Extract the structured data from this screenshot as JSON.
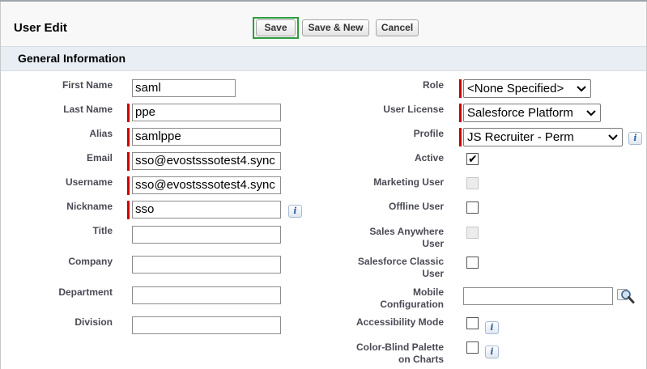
{
  "page": {
    "title": "User Edit"
  },
  "toolbar": {
    "save_label": "Save",
    "save_new_label": "Save & New",
    "cancel_label": "Cancel"
  },
  "section": {
    "title": "General Information"
  },
  "left_fields": {
    "first_name": {
      "label": "First Name",
      "value": "saml"
    },
    "last_name": {
      "label": "Last Name",
      "value": "ppe"
    },
    "alias": {
      "label": "Alias",
      "value": "samlppe"
    },
    "email": {
      "label": "Email",
      "value": "sso@evostsssotest4.sync"
    },
    "username": {
      "label": "Username",
      "value": "sso@evostsssotest4.sync"
    },
    "nickname": {
      "label": "Nickname",
      "value": "sso"
    },
    "title": {
      "label": "Title",
      "value": ""
    },
    "company": {
      "label": "Company",
      "value": ""
    },
    "department": {
      "label": "Department",
      "value": ""
    },
    "division": {
      "label": "Division",
      "value": ""
    }
  },
  "right_fields": {
    "role": {
      "label": "Role",
      "value": "<None Specified>"
    },
    "user_license": {
      "label": "User License",
      "value": "Salesforce Platform"
    },
    "profile": {
      "label": "Profile",
      "value": "JS Recruiter - Perm"
    },
    "active": {
      "label": "Active",
      "checked": true
    },
    "marketing_user": {
      "label": "Marketing User",
      "checked": false,
      "disabled": true
    },
    "offline_user": {
      "label": "Offline User",
      "checked": false
    },
    "sales_anywhere_user": {
      "label_line1": "Sales Anywhere",
      "label_line2": "User",
      "checked": false,
      "disabled": true
    },
    "salesforce_classic_user": {
      "label_line1": "Salesforce Classic",
      "label_line2": "User",
      "checked": false
    },
    "mobile_configuration": {
      "label_line1": "Mobile",
      "label_line2": "Configuration",
      "value": ""
    },
    "accessibility_mode": {
      "label": "Accessibility Mode",
      "checked": false
    },
    "color_blind_palette": {
      "label_line1": "Color-Blind Palette",
      "label_line2": "on Charts",
      "checked": false
    }
  },
  "icons": {
    "info": "info-icon",
    "lookup": "magnifier-lookup-icon",
    "dropdown": "chevron-down-icon",
    "check": "checkmark-icon"
  },
  "colors": {
    "required_bar": "#cc0000",
    "save_highlight": "#2e9e3e",
    "section_bg": "#e9eef4"
  }
}
